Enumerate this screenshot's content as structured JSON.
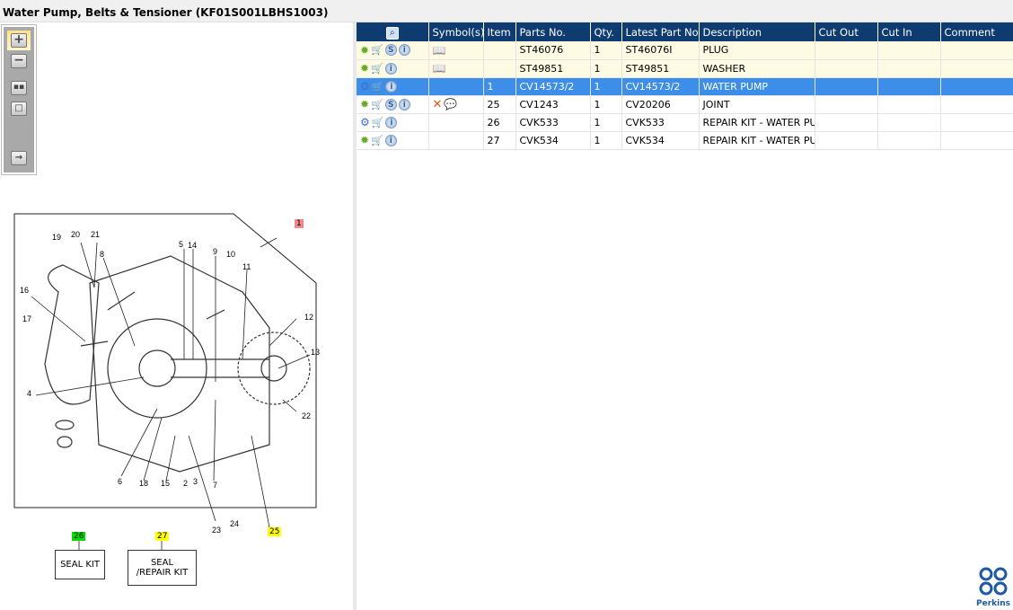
{
  "title": "Water Pump, Belts & Tensioner (KF01S001LBHS1003)",
  "toolbar": [
    "zoom-in",
    "zoom-out",
    "fit-all",
    "fit-window",
    "export"
  ],
  "table": {
    "headers": [
      "",
      "Symbol(s)",
      "Item",
      "Parts No.",
      "Qty.",
      "Latest Part No.",
      "Description",
      "Cut Out",
      "Cut In",
      "Comment"
    ],
    "rows": [
      {
        "icons": [
          "gear",
          "cart",
          "S",
          "i"
        ],
        "symbols": "book",
        "item": "",
        "part": "ST46076",
        "qty": "1",
        "latest": "ST46076I",
        "desc": "PLUG",
        "cutout": "",
        "cutin": "",
        "comment": ""
      },
      {
        "icons": [
          "gear",
          "cart",
          "i"
        ],
        "symbols": "book",
        "item": "",
        "part": "ST49851",
        "qty": "1",
        "latest": "ST49851",
        "desc": "WASHER",
        "cutout": "",
        "cutin": "",
        "comment": ""
      },
      {
        "icons": [
          "gears",
          "cart",
          "i"
        ],
        "symbols": "",
        "item": "1",
        "part": "CV14573/2",
        "qty": "1",
        "latest": "CV14573/2",
        "desc": "WATER PUMP",
        "cutout": "",
        "cutin": "",
        "comment": ""
      },
      {
        "icons": [
          "gear",
          "cart",
          "S",
          "i"
        ],
        "symbols": "x-comment",
        "item": "25",
        "part": "CV1243",
        "qty": "1",
        "latest": "CV20206",
        "desc": "JOINT",
        "cutout": "",
        "cutin": "",
        "comment": ""
      },
      {
        "icons": [
          "gears",
          "cart",
          "i"
        ],
        "symbols": "",
        "item": "26",
        "part": "CVK533",
        "qty": "1",
        "latest": "CVK533",
        "desc": "REPAIR KIT - WATER PUM",
        "cutout": "",
        "cutin": "",
        "comment": ""
      },
      {
        "icons": [
          "gear",
          "cart",
          "i"
        ],
        "symbols": "",
        "item": "27",
        "part": "CVK534",
        "qty": "1",
        "latest": "CVK534",
        "desc": "REPAIR KIT - WATER PUM",
        "cutout": "",
        "cutin": "",
        "comment": ""
      }
    ]
  },
  "diagram": {
    "callouts": [
      "19",
      "20",
      "21",
      "8",
      "5",
      "14",
      "9",
      "10",
      "11",
      "16",
      "17",
      "12",
      "13",
      "4",
      "22",
      "6",
      "18",
      "15",
      "2",
      "3",
      "7",
      "23",
      "24"
    ],
    "tags": {
      "t1": "1",
      "t25": "25",
      "t26": "26",
      "t27": "27"
    },
    "kits": {
      "seal": "SEAL KIT",
      "seal_repair": "SEAL /REPAIR KIT"
    }
  },
  "logo": "Perkins"
}
